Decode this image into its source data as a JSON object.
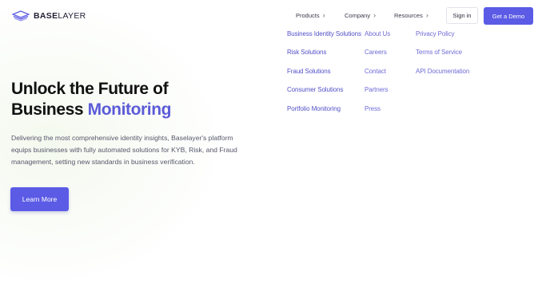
{
  "brand": {
    "name_bold": "BASE",
    "name_light": "LAYER",
    "logo_icon": "stacked-layers-icon",
    "accent": "#5b5be6"
  },
  "nav": {
    "items": [
      {
        "label": "Products"
      },
      {
        "label": "Company"
      },
      {
        "label": "Resources"
      }
    ],
    "signin_label": "Sign in",
    "demo_label": "Get a Demo"
  },
  "menu": {
    "products": [
      "Business Identity Solutions",
      "Risk Solutions",
      "Fraud Solutions",
      "Consumer Solutions",
      "Portfolio Monitoring"
    ],
    "company": [
      "About Us",
      "Careers",
      "Contact",
      "Partners",
      "Press"
    ],
    "resources": [
      "Privacy Policy",
      "Terms of Service",
      "API Documentation"
    ]
  },
  "hero": {
    "headline_line1": "Unlock the Future of",
    "headline_line2": "Business",
    "headline_accent": "Monitoring",
    "paragraph": "Delivering the most comprehensive identity insights, Baselayer's platform equips businesses with fully automated solutions for KYB, Risk, and Fraud management, setting new standards in business verification.",
    "cta_label": "Learn More"
  }
}
